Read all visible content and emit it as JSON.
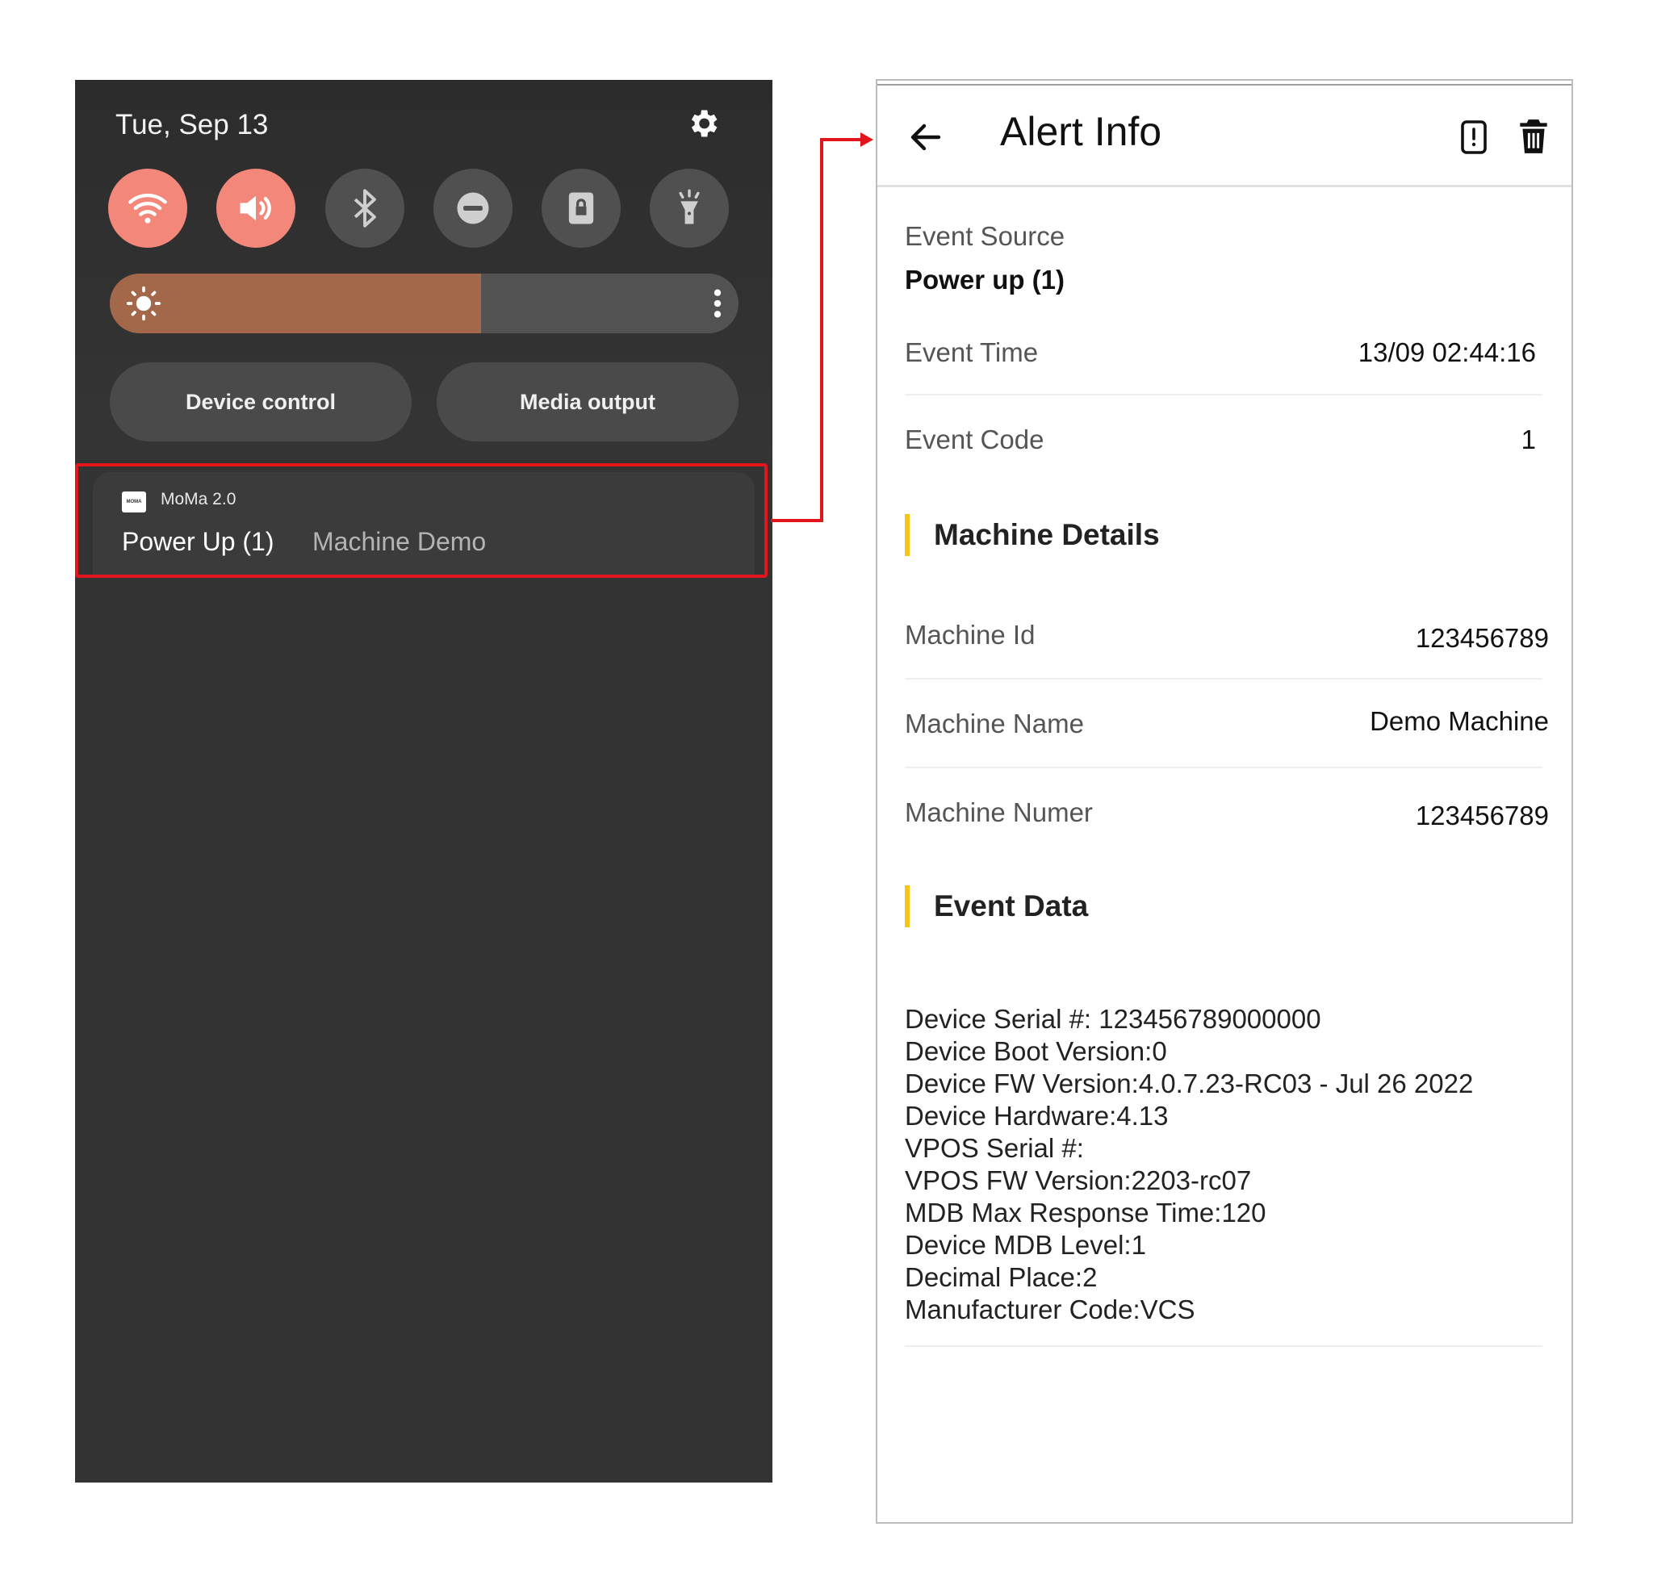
{
  "quick_settings": {
    "date": "Tue, Sep 13",
    "tiles": [
      {
        "icon": "wifi-icon",
        "state": "on"
      },
      {
        "icon": "sound-icon",
        "state": "on"
      },
      {
        "icon": "bluetooth-icon",
        "state": "off"
      },
      {
        "icon": "do-not-disturb-icon",
        "state": "off"
      },
      {
        "icon": "lock-icon",
        "state": "off"
      },
      {
        "icon": "flashlight-icon",
        "state": "off"
      }
    ],
    "brightness_level": 0.59,
    "device_control_label": "Device control",
    "media_output_label": "Media output",
    "accent_on": "#f2877a",
    "brightness_color": "#a3674a"
  },
  "notification": {
    "app_name": "MoMa 2.0",
    "app_icon_text": "MOMA",
    "title": "Power Up (1)",
    "subtitle": "Machine Demo",
    "highlight_color": "#e3151c"
  },
  "alert_info": {
    "title": "Alert Info",
    "event_source_label": "Event Source",
    "event_source_value": "Power up (1)",
    "event_time_label": "Event Time",
    "event_time_value": "13/09 02:44:16",
    "event_code_label": "Event Code",
    "event_code_value": "1",
    "machine_details_heading": "Machine Details",
    "machine_id_label": "Machine Id",
    "machine_id_value": "123456789",
    "machine_name_label": "Machine Name",
    "machine_name_value": "Demo Machine",
    "machine_number_label": "Machine Numer",
    "machine_number_value": "123456789",
    "event_data_heading": "Event Data",
    "event_data_lines": [
      "Device Serial #: 123456789000000",
      "Device Boot Version:0",
      "Device FW Version:4.0.7.23-RC03 - Jul 26 2022",
      "Device Hardware:4.13",
      "VPOS Serial #:",
      "VPOS FW Version:2203-rc07",
      "MDB Max Response Time:120",
      "Device MDB Level:1",
      "Decimal Place:2",
      "Manufacturer Code:VCS"
    ],
    "section_accent": "#f5c518"
  }
}
